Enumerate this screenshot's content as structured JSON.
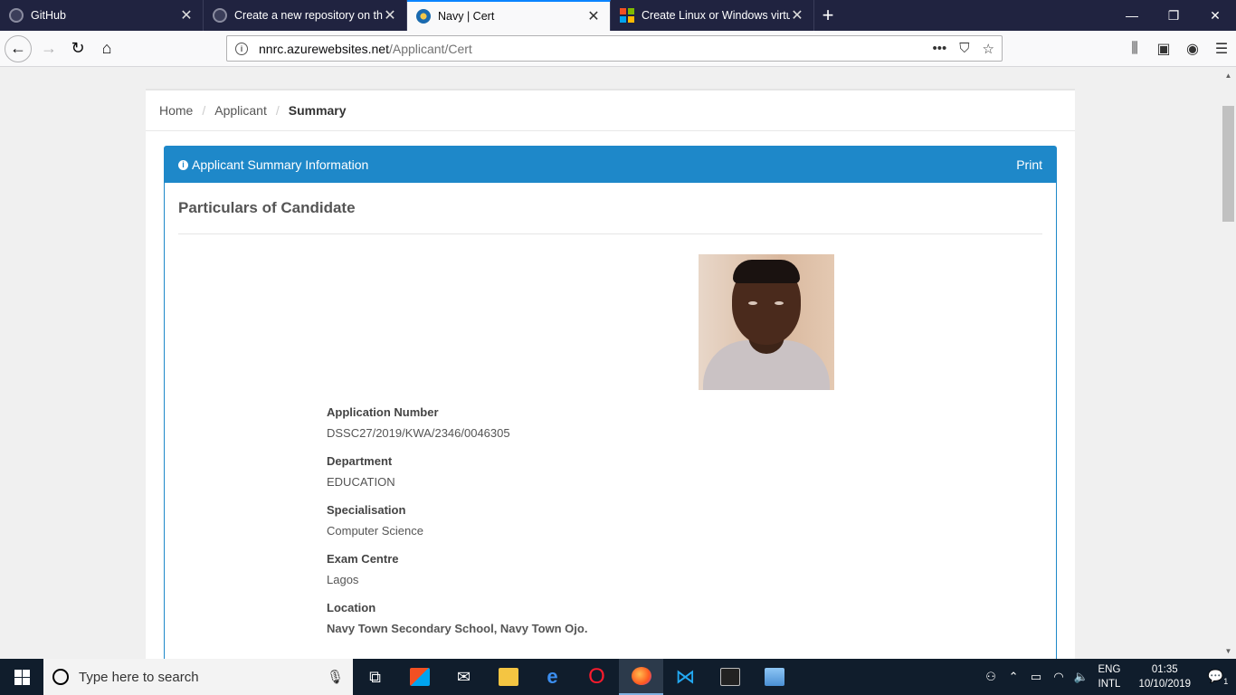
{
  "tabs": [
    {
      "title": "GitHub",
      "favicon": "github-icon",
      "active": false
    },
    {
      "title": "Create a new repository on the",
      "favicon": "github-icon",
      "active": false
    },
    {
      "title": "Navy | Cert",
      "favicon": "navy-crest-icon",
      "active": true
    },
    {
      "title": "Create Linux or Windows virtua",
      "favicon": "microsoft-icon",
      "active": false
    }
  ],
  "address": {
    "domain": "nnrc.azurewebsites.net",
    "path": "/Applicant/Cert"
  },
  "breadcrumb": {
    "home": "Home",
    "applicant": "Applicant",
    "current": "Summary"
  },
  "panel": {
    "heading": "Applicant Summary Information",
    "print": "Print",
    "section_title": "Particulars of Candidate"
  },
  "fields": [
    {
      "label": "Application Number",
      "value": "DSSC27/2019/KWA/2346/0046305"
    },
    {
      "label": "Department",
      "value": "EDUCATION"
    },
    {
      "label": "Specialisation",
      "value": "Computer Science"
    },
    {
      "label": "Exam Centre",
      "value": "Lagos"
    },
    {
      "label": "Location",
      "value": "Navy Town Secondary School, Navy Town Ojo."
    }
  ],
  "taskbar": {
    "search_placeholder": "Type here to search",
    "lang_top": "ENG",
    "lang_bottom": "INTL",
    "time": "01:35",
    "date": "10/10/2019",
    "notification_count": "1"
  },
  "colors": {
    "panel_accent": "#1e88c9",
    "tab_strip": "#202340",
    "taskbar": "#101d2c"
  }
}
